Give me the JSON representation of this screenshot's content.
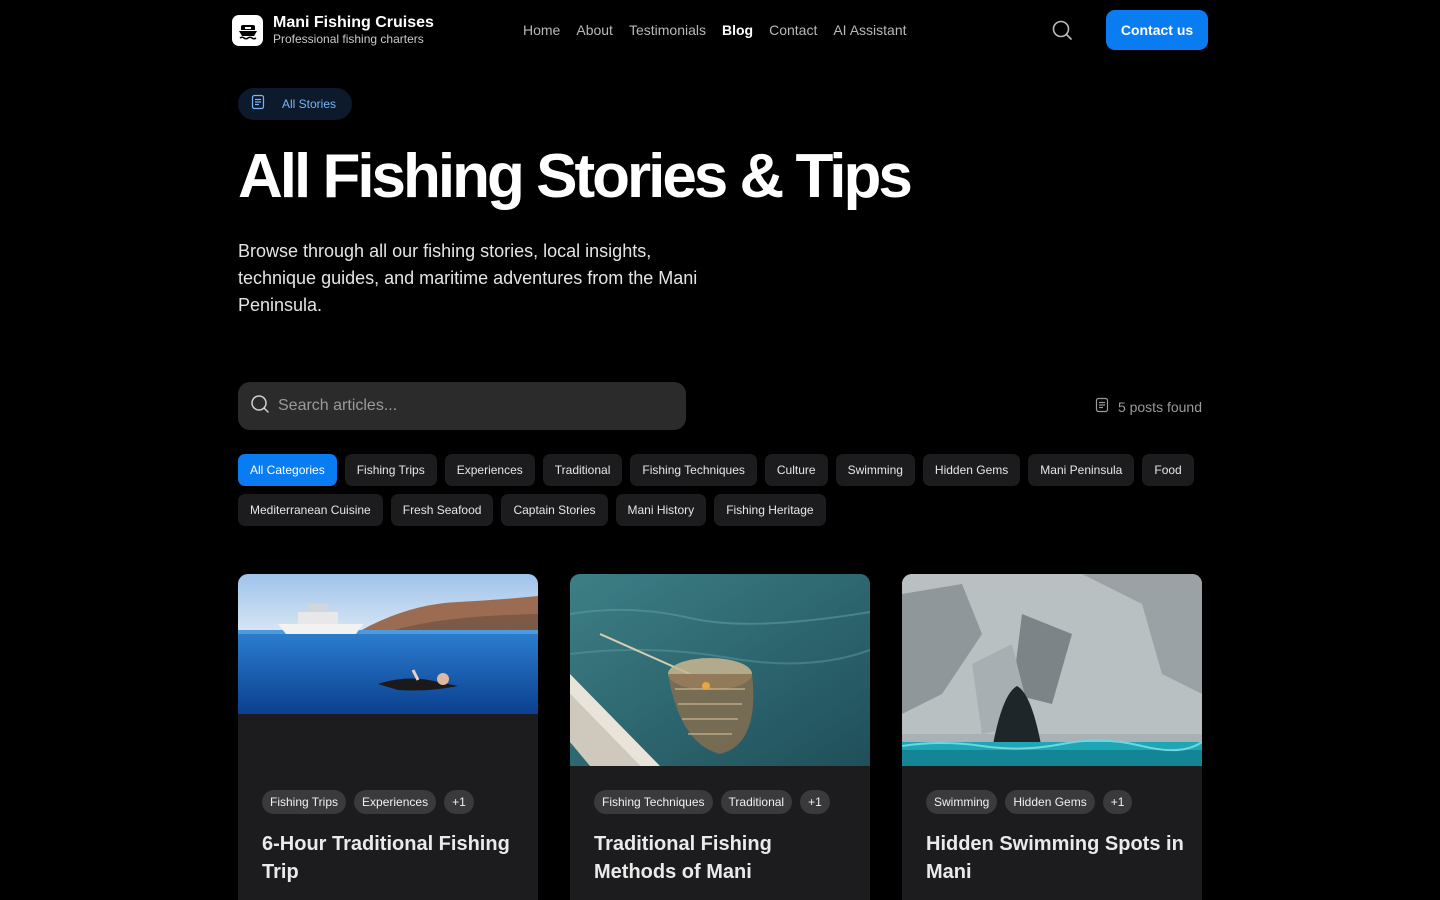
{
  "brand": {
    "title": "Mani Fishing Cruises",
    "subtitle": "Professional fishing charters"
  },
  "nav": {
    "items": [
      {
        "label": "Home"
      },
      {
        "label": "About"
      },
      {
        "label": "Testimonials"
      },
      {
        "label": "Blog",
        "active": true
      },
      {
        "label": "Contact"
      },
      {
        "label": "AI Assistant"
      }
    ],
    "search_icon": "search-icon",
    "contact_label": "Contact us"
  },
  "hero": {
    "pill_label": "All Stories",
    "pill_icon": "document-icon",
    "title": "All Fishing Stories & Tips",
    "description": "Browse through all our fishing stories, local insights, technique guides, and maritime adventures from the Mani Peninsula."
  },
  "search": {
    "placeholder": "Search articles...",
    "posts_found": "5 posts found"
  },
  "categories": [
    {
      "label": "All Categories",
      "active": true
    },
    {
      "label": "Fishing Trips"
    },
    {
      "label": "Experiences"
    },
    {
      "label": "Traditional"
    },
    {
      "label": "Fishing Techniques"
    },
    {
      "label": "Culture"
    },
    {
      "label": "Swimming"
    },
    {
      "label": "Hidden Gems"
    },
    {
      "label": "Mani Peninsula"
    },
    {
      "label": "Food"
    },
    {
      "label": "Mediterranean Cuisine"
    },
    {
      "label": "Fresh Seafood"
    },
    {
      "label": "Captain Stories"
    },
    {
      "label": "Mani History"
    },
    {
      "label": "Fishing Heritage"
    }
  ],
  "posts": [
    {
      "tags": [
        "Fishing Trips",
        "Experiences",
        "+1"
      ],
      "title": "6-Hour Traditional Fishing Trip"
    },
    {
      "tags": [
        "Fishing Techniques",
        "Traditional",
        "+1"
      ],
      "title": "Traditional Fishing Methods of Mani"
    },
    {
      "tags": [
        "Swimming",
        "Hidden Gems",
        "+1"
      ],
      "title": "Hidden Swimming Spots in Mani"
    }
  ],
  "colors": {
    "accent": "#0a7cf2",
    "background": "#000000",
    "card": "#1c1c1e"
  }
}
